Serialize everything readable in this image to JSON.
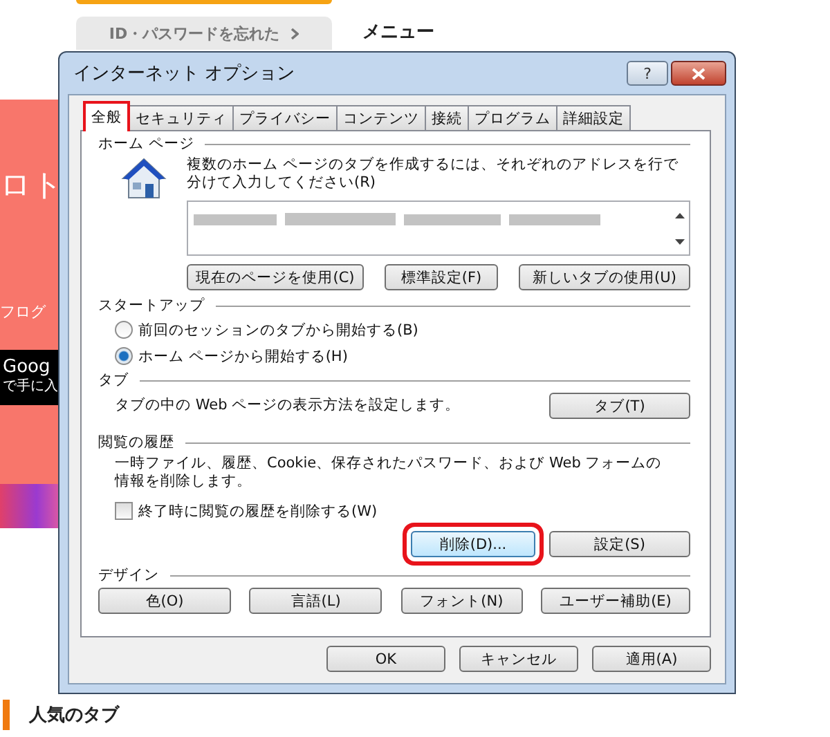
{
  "background_page": {
    "login_help_button": "ID・パスワードを忘れた",
    "menu_heading": "メニュー",
    "banner": {
      "headline": "ロト",
      "subline": "フログ",
      "store_badge": [
        "Goog",
        "で手に入"
      ]
    },
    "section_heading": "人気のタブ"
  },
  "dialog": {
    "title": "インターネット オプション",
    "help_button": "?",
    "tabs": [
      {
        "label": "全般",
        "selected": true,
        "highlighted": true
      },
      {
        "label": "セキュリティ",
        "selected": false,
        "highlighted": false
      },
      {
        "label": "プライバシー",
        "selected": false,
        "highlighted": false
      },
      {
        "label": "コンテンツ",
        "selected": false,
        "highlighted": false
      },
      {
        "label": "接続",
        "selected": false,
        "highlighted": false
      },
      {
        "label": "プログラム",
        "selected": false,
        "highlighted": false
      },
      {
        "label": "詳細設定",
        "selected": false,
        "highlighted": false
      }
    ],
    "home_page": {
      "label": "ホーム ページ",
      "description": "複数のホーム ページのタブを作成するには、それぞれのアドレスを行で分けて入力してください(R)",
      "buttons": [
        {
          "label": "現在のページを使用(C)",
          "highlighted": false
        },
        {
          "label": "標準設定(F)",
          "highlighted": false
        },
        {
          "label": "新しいタブの使用(U)",
          "highlighted": false
        }
      ]
    },
    "startup": {
      "label": "スタートアップ",
      "options": [
        {
          "label": "前回のセッションのタブから開始する(B)",
          "selected": false
        },
        {
          "label": "ホーム ページから開始する(H)",
          "selected": true
        }
      ]
    },
    "tab_settings": {
      "label": "タブ",
      "description": "タブの中の Web ページの表示方法を設定します。",
      "button": {
        "label": "タブ(T)",
        "highlighted": false
      }
    },
    "history": {
      "label": "閲覧の履歴",
      "description": "一時ファイル、履歴、Cookie、保存されたパスワード、および Web フォームの情報を削除します。",
      "checkbox": {
        "label": "終了時に閲覧の履歴を削除する(W)",
        "checked": false
      },
      "buttons": [
        {
          "label": "削除(D)...",
          "highlighted": true
        },
        {
          "label": "設定(S)",
          "highlighted": false
        }
      ]
    },
    "design": {
      "label": "デザイン",
      "buttons": [
        {
          "label": "色(O)",
          "highlighted": false
        },
        {
          "label": "言語(L)",
          "highlighted": false
        },
        {
          "label": "フォント(N)",
          "highlighted": false
        },
        {
          "label": "ユーザー補助(E)",
          "highlighted": false
        }
      ]
    },
    "footer_buttons": [
      {
        "label": "OK",
        "highlighted": false
      },
      {
        "label": "キャンセル",
        "highlighted": false
      },
      {
        "label": "適用(A)",
        "highlighted": false
      }
    ]
  }
}
